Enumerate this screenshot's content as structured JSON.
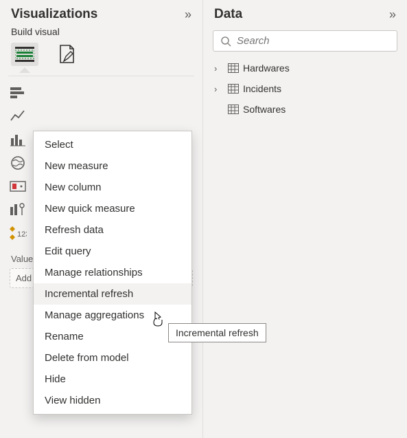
{
  "viz": {
    "title": "Visualizations",
    "subheader": "Build visual",
    "section_values": "Values",
    "field_placeholder": "Add data fields here"
  },
  "data_pane": {
    "title": "Data",
    "search_placeholder": "Search",
    "tables": [
      {
        "name": "Hardwares"
      },
      {
        "name": "Incidents"
      },
      {
        "name": "Softwares"
      }
    ]
  },
  "context_menu": {
    "items": [
      "Select",
      "New measure",
      "New column",
      "New quick measure",
      "Refresh data",
      "Edit query",
      "Manage relationships",
      "Incremental refresh",
      "Manage aggregations",
      "Rename",
      "Delete from model",
      "Hide",
      "View hidden"
    ],
    "hovered_index": 7
  },
  "tooltip": "Incremental refresh"
}
